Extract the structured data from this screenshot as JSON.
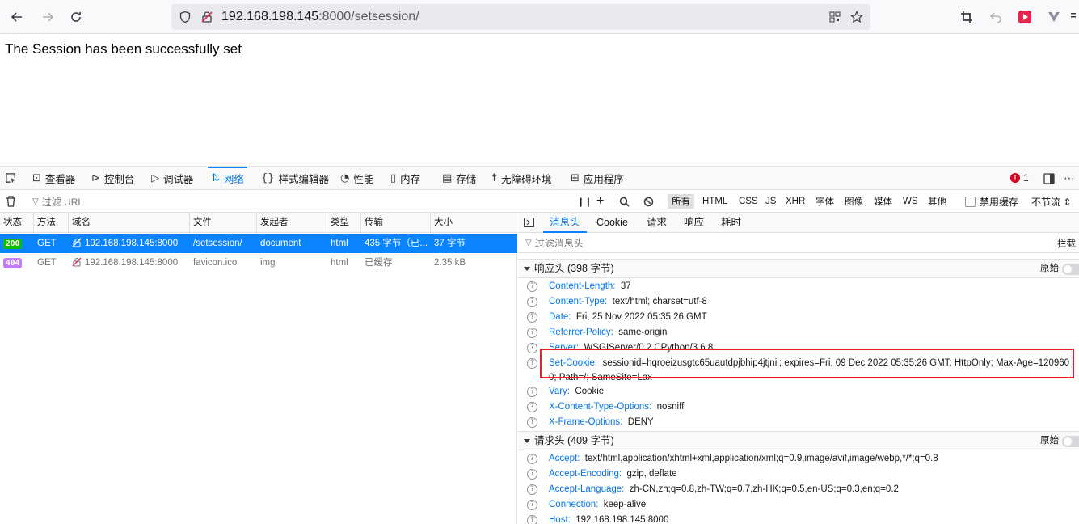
{
  "browser": {
    "url_host": "192.168.198.145",
    "url_rest": ":8000/setsession/"
  },
  "page": {
    "message": "The Session has been successfully set"
  },
  "devtools": {
    "tabs": [
      {
        "label": "查看器",
        "icon": "inspector-icon"
      },
      {
        "label": "控制台",
        "icon": "console-icon"
      },
      {
        "label": "调试器",
        "icon": "debugger-icon"
      },
      {
        "label": "网络",
        "icon": "network-icon"
      },
      {
        "label": "样式编辑器",
        "icon": "style-editor-icon"
      },
      {
        "label": "性能",
        "icon": "performance-icon"
      },
      {
        "label": "内存",
        "icon": "memory-icon"
      },
      {
        "label": "存储",
        "icon": "storage-icon"
      },
      {
        "label": "无障碍环境",
        "icon": "accessibility-icon"
      },
      {
        "label": "应用程序",
        "icon": "application-icon"
      }
    ],
    "error_count": "1",
    "filter": {
      "placeholder": "过滤 URL",
      "types": [
        "所有",
        "HTML",
        "CSS",
        "JS",
        "XHR",
        "字体",
        "图像",
        "媒体",
        "WS",
        "其他"
      ],
      "disable_cache": "禁用缓存",
      "throttle": "不节流 ⇕"
    },
    "table": {
      "headers": [
        "状态",
        "方法",
        "域名",
        "文件",
        "发起者",
        "类型",
        "传输",
        "大小"
      ],
      "rows": [
        {
          "status": "200",
          "method": "GET",
          "domain": "192.168.198.145:8000",
          "file": "/setsession/",
          "initiator": "document",
          "type": "html",
          "transfer": "435 字节（已...",
          "size": "37 字节"
        },
        {
          "status": "404",
          "method": "GET",
          "domain": "192.168.198.145:8000",
          "file": "favicon.ico",
          "initiator": "img",
          "type": "html",
          "transfer": "已缓存",
          "size": "2.35 kB"
        }
      ]
    },
    "side": {
      "tabs": [
        "消息头",
        "Cookie",
        "请求",
        "响应",
        "耗时"
      ],
      "filter_placeholder": "过滤消息头",
      "block_label": "拦截",
      "raw_label": "原始",
      "response_section": "响应头 (398 字节)",
      "request_section": "请求头 (409 字节)",
      "response_headers": [
        {
          "name": "Content-Length:",
          "value": "37"
        },
        {
          "name": "Content-Type:",
          "value": "text/html; charset=utf-8"
        },
        {
          "name": "Date:",
          "value": "Fri, 25 Nov 2022 05:35:26 GMT"
        },
        {
          "name": "Referrer-Policy:",
          "value": "same-origin"
        },
        {
          "name": "Server:",
          "value": "WSGIServer/0.2 CPython/3.6.8"
        },
        {
          "name": "Set-Cookie:",
          "value": "sessionid=hqroeizusgtc65uautdpjbhip4jtjnii; expires=Fri, 09 Dec 2022 05:35:26 GMT; HttpOnly; Max-Age=1209600; Path=/; SameSite=Lax"
        },
        {
          "name": "Vary:",
          "value": "Cookie"
        },
        {
          "name": "X-Content-Type-Options:",
          "value": "nosniff"
        },
        {
          "name": "X-Frame-Options:",
          "value": "DENY"
        }
      ],
      "request_headers": [
        {
          "name": "Accept:",
          "value": "text/html,application/xhtml+xml,application/xml;q=0.9,image/avif,image/webp,*/*;q=0.8"
        },
        {
          "name": "Accept-Encoding:",
          "value": "gzip, deflate"
        },
        {
          "name": "Accept-Language:",
          "value": "zh-CN,zh;q=0.8,zh-TW;q=0.7,zh-HK;q=0.5,en-US;q=0.3,en;q=0.2"
        },
        {
          "name": "Connection:",
          "value": "keep-alive"
        },
        {
          "name": "Host:",
          "value": "192.168.198.145:8000"
        }
      ]
    }
  }
}
